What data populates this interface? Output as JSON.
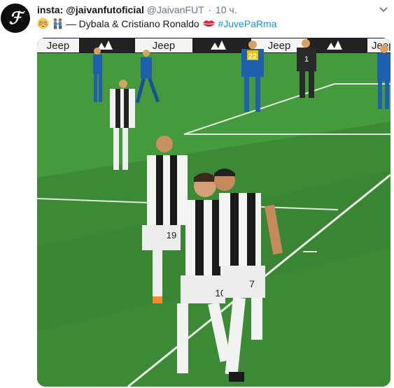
{
  "tweet": {
    "avatar_letter": "ℱ",
    "author_name": "insta: @jaivanfutoficial",
    "author_handle": "@JaivanFUT",
    "separator": "·",
    "timestamp": "10 ч.",
    "text_main": "— Dybala & Cristiano Ronaldo",
    "hashtag": "#JuvePaRma"
  },
  "media": {
    "board_text": "Jeep",
    "player_numbers": {
      "bonucci": "19",
      "dybala": "10",
      "ronaldo": "7",
      "parma_player": "22",
      "goalkeeper": "1"
    }
  },
  "colors": {
    "pitch": "#3d8a36",
    "hashtag": "#1b95e0",
    "muted": "#657786"
  },
  "icons": [
    "avatar-logo",
    "chevron-down-icon",
    "flushed-face-icon",
    "men-holding-hands-icon",
    "kiss-mark-icon"
  ]
}
